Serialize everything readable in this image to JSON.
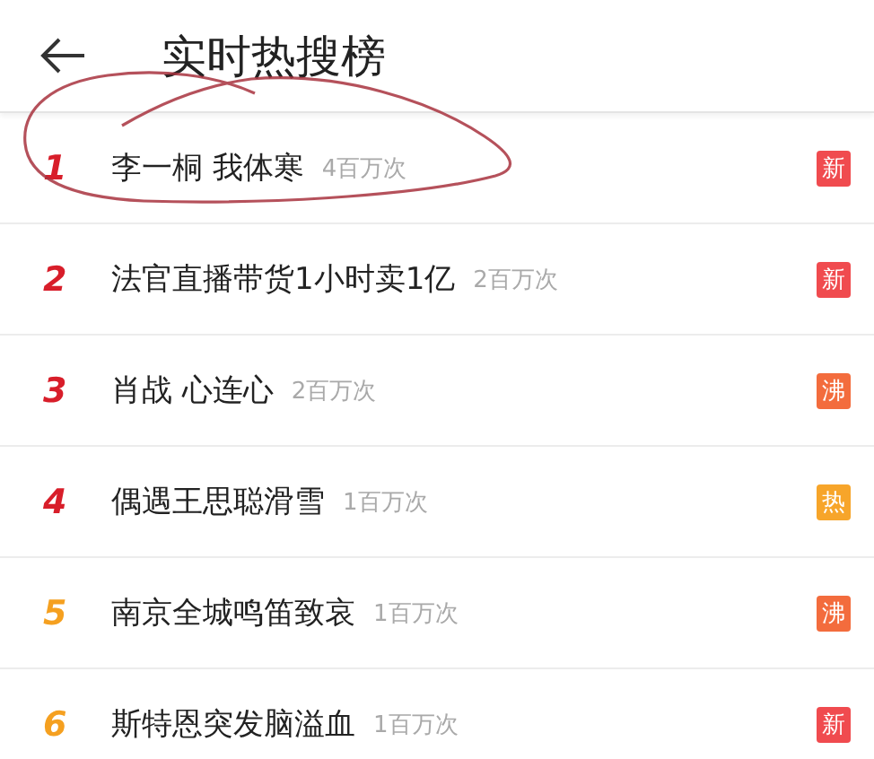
{
  "header": {
    "title": "实时热搜榜"
  },
  "items": [
    {
      "rank": {
        "text": "1",
        "color": "#d81e2a"
      },
      "title": "李一桐 我体寒",
      "count": "4百万次",
      "badge": {
        "text": "新",
        "color": "#f04b4f"
      }
    },
    {
      "rank": {
        "text": "2",
        "color": "#d81e2a"
      },
      "title": "法官直播带货1小时卖1亿",
      "count": "2百万次",
      "badge": {
        "text": "新",
        "color": "#f04b4f"
      }
    },
    {
      "rank": {
        "text": "3",
        "color": "#d81e2a"
      },
      "title": "肖战 心连心",
      "count": "2百万次",
      "badge": {
        "text": "沸",
        "color": "#f36c3d"
      }
    },
    {
      "rank": {
        "text": "4",
        "color": "#d81e2a"
      },
      "title": "偶遇王思聪滑雪",
      "count": "1百万次",
      "badge": {
        "text": "热",
        "color": "#f7a52a"
      }
    },
    {
      "rank": {
        "text": "5",
        "color": "#f5a020"
      },
      "title": "南京全城鸣笛致哀",
      "count": "1百万次",
      "badge": {
        "text": "沸",
        "color": "#f36c3d"
      }
    },
    {
      "rank": {
        "text": "6",
        "color": "#f5a020"
      },
      "title": "斯特恩突发脑溢血",
      "count": "1百万次",
      "badge": {
        "text": "新",
        "color": "#f04b4f"
      }
    }
  ]
}
